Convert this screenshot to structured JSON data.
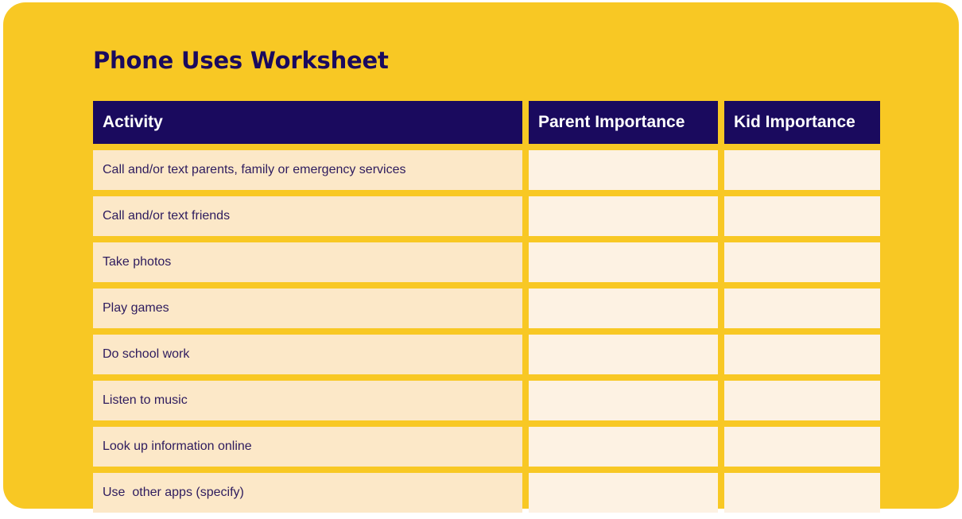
{
  "title": "Phone Uses Worksheet",
  "colors": {
    "card_background": "#F8C824",
    "header_background": "#1A0A5E",
    "header_text": "#FFFFFF",
    "activity_cell": "#FCE8C8",
    "answer_cell": "#FDF2E3",
    "body_text": "#2D1B5E"
  },
  "table": {
    "headers": {
      "activity": "Activity",
      "parent": "Parent Importance",
      "kid": "Kid Importance"
    },
    "rows": [
      {
        "activity": "Call and/or text parents, family or emergency services",
        "parent": "",
        "kid": ""
      },
      {
        "activity": "Call and/or text friends",
        "parent": "",
        "kid": ""
      },
      {
        "activity": "Take photos",
        "parent": "",
        "kid": ""
      },
      {
        "activity": "Play games",
        "parent": "",
        "kid": ""
      },
      {
        "activity": "Do school work",
        "parent": "",
        "kid": ""
      },
      {
        "activity": "Listen to music",
        "parent": "",
        "kid": ""
      },
      {
        "activity": "Look up information online",
        "parent": "",
        "kid": ""
      },
      {
        "activity": "Use  other apps (specify)",
        "parent": "",
        "kid": ""
      }
    ]
  }
}
